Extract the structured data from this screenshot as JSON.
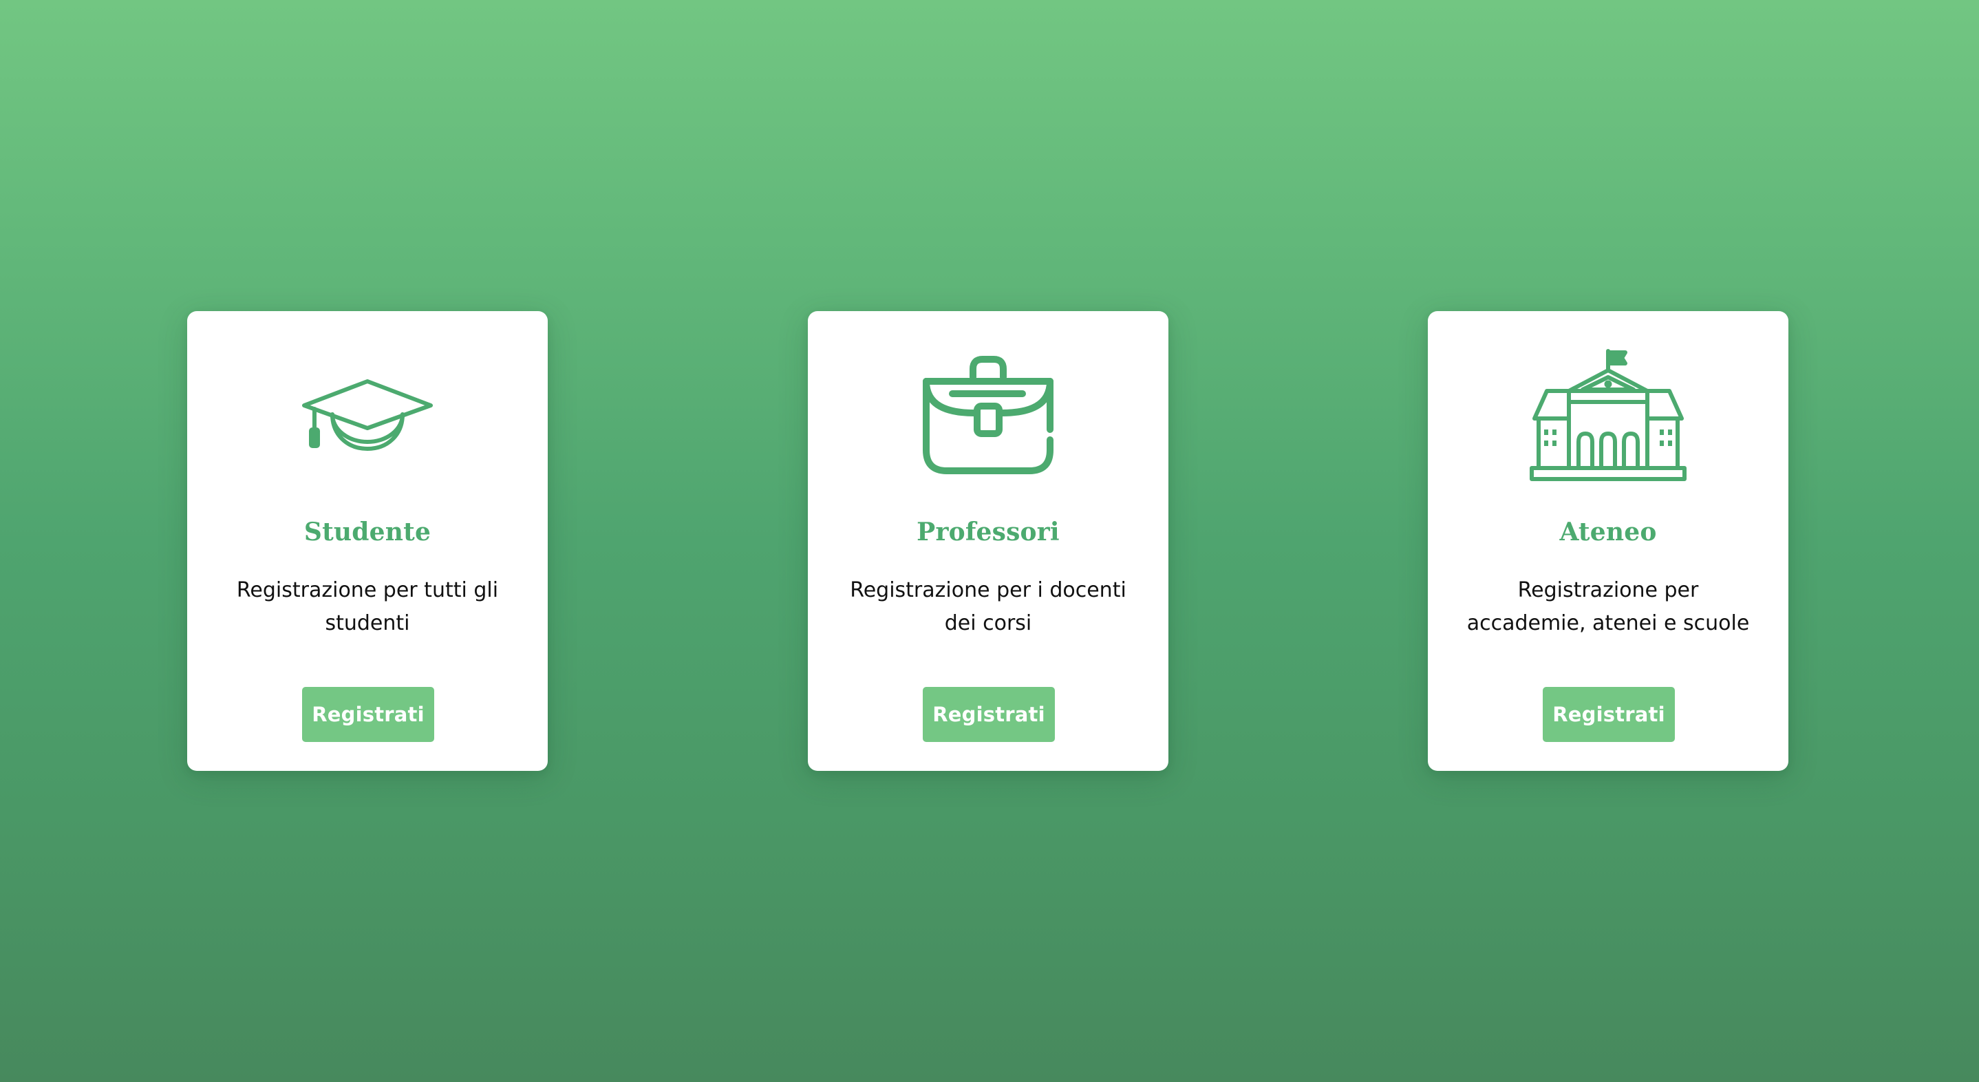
{
  "colors": {
    "accent": "#4caa6f",
    "button": "#74c784",
    "button_text": "#ffffff",
    "card_bg": "#ffffff",
    "background_top": "#72c682",
    "background_bottom": "#47895d"
  },
  "cards": [
    {
      "icon": "graduation-cap-icon",
      "title": "Studente",
      "description": "Registrazione per tutti gli studenti",
      "button_label": "Registrati"
    },
    {
      "icon": "briefcase-icon",
      "title": "Professori",
      "description": "Registrazione per i docenti dei corsi",
      "button_label": "Registrati"
    },
    {
      "icon": "university-building-icon",
      "title": "Ateneo",
      "description": "Registrazione per accademie, atenei e scuole",
      "button_label": "Registrati"
    }
  ]
}
